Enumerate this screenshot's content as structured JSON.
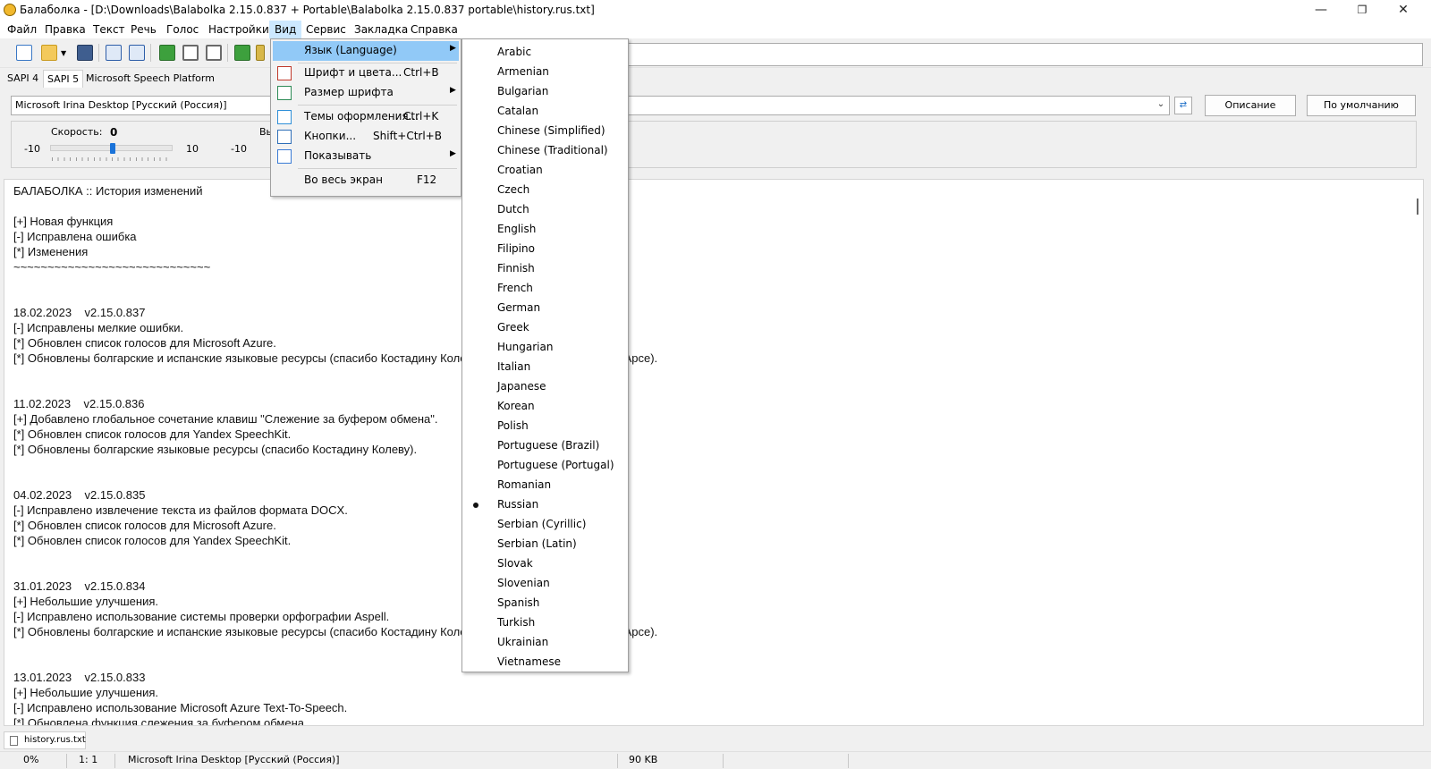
{
  "window": {
    "title": "Балаболка - [D:\\Downloads\\Balabolka 2.15.0.837 + Portable\\Balabolka 2.15.0.837 portable\\history.rus.txt]",
    "icon": "app-smiley-icon",
    "controls": {
      "minimize": "—",
      "maximize": "❐",
      "close": "✕"
    }
  },
  "menubar": [
    "Файл",
    "Правка",
    "Текст",
    "Речь",
    "Голос",
    "Настройки",
    "Вид",
    "Сервис",
    "Закладка",
    "Справка"
  ],
  "toolbar": {
    "icons": [
      "new-document-icon",
      "open-folder-icon",
      "dropdown-arrow-icon",
      "save-icon",
      "export-audio-icon",
      "export-batch-icon",
      "play-icon",
      "pause-icon",
      "stop-icon",
      "read-clipboard-icon",
      "convert-icon"
    ]
  },
  "sapi_tabs": [
    "SAPI 4",
    "SAPI 5",
    "Microsoft Speech Platform"
  ],
  "voice_panel": {
    "selected_voice": "Microsoft Irina Desktop [Русский (Россия)]",
    "describe_button": "Описание",
    "default_button": "По умолчанию",
    "speed_label": "Скорость:",
    "speed_value": "0",
    "speed_value_fraction": 0.5,
    "speed_min": "-10",
    "speed_max": "10",
    "second_min": "-10",
    "second_label_partial": "Вы"
  },
  "view_menu": {
    "items": [
      {
        "label": "Язык (Language)",
        "shortcut": "",
        "submenu": true,
        "icon": "",
        "highlighted": true
      },
      {
        "label": "Шрифт и цвета...",
        "shortcut": "Ctrl+B",
        "submenu": false,
        "icon": "font-color-icon"
      },
      {
        "label": "Размер шрифта",
        "shortcut": "",
        "submenu": true,
        "icon": "font-size-icon"
      },
      {
        "label": "Темы оформления...",
        "shortcut": "Ctrl+K",
        "submenu": false,
        "icon": "themes-icon"
      },
      {
        "label": "Кнопки...",
        "shortcut": "Shift+Ctrl+B",
        "submenu": false,
        "icon": "buttons-icon"
      },
      {
        "label": "Показывать",
        "shortcut": "",
        "submenu": true,
        "icon": "show-panels-icon"
      },
      {
        "label": "Во весь экран",
        "shortcut": "F12",
        "submenu": false,
        "icon": ""
      }
    ]
  },
  "language_menu": {
    "selected": "Russian",
    "items": [
      "Arabic",
      "Armenian",
      "Bulgarian",
      "Catalan",
      "Chinese (Simplified)",
      "Chinese (Traditional)",
      "Croatian",
      "Czech",
      "Dutch",
      "English",
      "Filipino",
      "Finnish",
      "French",
      "German",
      "Greek",
      "Hungarian",
      "Italian",
      "Japanese",
      "Korean",
      "Polish",
      "Portuguese (Brazil)",
      "Portuguese (Portugal)",
      "Romanian",
      "Russian",
      "Serbian (Cyrillic)",
      "Serbian (Latin)",
      "Slovak",
      "Slovenian",
      "Spanish",
      "Turkish",
      "Ukrainian",
      "Vietnamese"
    ]
  },
  "editor": {
    "lines": [
      "БАЛАБОЛКА :: История изменений",
      "",
      "[+] Новая функция",
      "[-] Исправлена ошибка",
      "[*] Изменения",
      "~~~~~~~~~~~~~~~~~~~~~~~~~~~~~",
      "",
      "",
      "18.02.2023    v2.15.0.837",
      "[-] Исправлены мелкие ошибки.",
      "[*] Обновлен список голосов для Microsoft Azure.",
      "[*] Обновлены болгарские и испанские языковые ресурсы (спасибо Костадину Колеву и Фернандо Гонсалесу де Арсе).",
      "",
      "",
      "11.02.2023    v2.15.0.836",
      "[+] Добавлено глобальное сочетание клавиш \"Слежение за буфером обмена\".",
      "[*] Обновлен список голосов для Yandex SpeechKit.",
      "[*] Обновлены болгарские языковые ресурсы (спасибо Костадину Колеву).",
      "",
      "",
      "04.02.2023    v2.15.0.835",
      "[-] Исправлено извлечение текста из файлов формата DOCX.",
      "[*] Обновлен список голосов для Microsoft Azure.",
      "[*] Обновлен список голосов для Yandex SpeechKit.",
      "",
      "",
      "31.01.2023    v2.15.0.834",
      "[+] Небольшие улучшения.",
      "[-] Исправлено использование системы проверки орфографии Aspell.",
      "[*] Обновлены болгарские и испанские языковые ресурсы (спасибо Костадину Колеву и Фернандо Гонсалесу де Арсе).",
      "",
      "",
      "13.01.2023    v2.15.0.833",
      "[+] Небольшие улучшения.",
      "[-] Исправлено использование Microsoft Azure Text-To-Speech.",
      "[*] Обновлена функция слежения за буфером обмена."
    ]
  },
  "file_tab": {
    "label": "history.rus.txt",
    "icon": "text-file-icon"
  },
  "statusbar": {
    "percent": "0%",
    "position": "1:   1",
    "voice": "Microsoft Irina Desktop [Русский (Россия)]",
    "size": "90 KB"
  }
}
